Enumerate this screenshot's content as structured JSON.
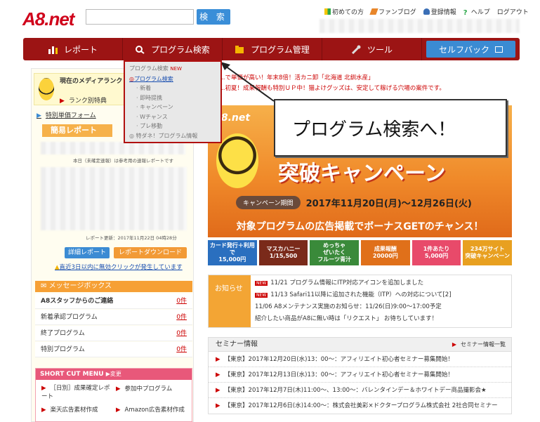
{
  "header": {
    "logo": "A8.net",
    "search_placeholder": "",
    "search_button": "検 索",
    "links": [
      {
        "icon": "beginner-icon",
        "label": "初めての方"
      },
      {
        "icon": "pen-icon",
        "label": "ファンブログ"
      },
      {
        "icon": "user-icon",
        "label": "登録情報"
      },
      {
        "icon": "help-icon",
        "label": "ヘルプ"
      },
      {
        "icon": "",
        "label": "ログアウト"
      }
    ]
  },
  "nav": {
    "items": [
      {
        "icon": "chart-icon",
        "label": "レポート"
      },
      {
        "icon": "search-icon",
        "label": "プログラム検索"
      },
      {
        "icon": "folder-icon",
        "label": "プログラム管理"
      },
      {
        "icon": "wrench-icon",
        "label": "ツール"
      }
    ],
    "selfback": "セルフバック"
  },
  "dropdown": {
    "title": "プログラム検索",
    "badge": "NEW",
    "items": [
      "プログラム検索",
      "新着",
      "即時提携",
      "キャンペーン",
      "Wチャンス",
      "プレ移動"
    ],
    "footer": "特ダネ！プログラム情報"
  },
  "callout": "プログラム検索へ！",
  "left": {
    "media_title": "現在のメディアランク",
    "rank_link": "ランク別特典",
    "price_form": "特別単価フォーム",
    "report_head": "簡易レポート",
    "report_note": "本日（未確定速報）は参考用の速報レポートです",
    "report_updated": "レポート更新：2017年11月22日 04時28分",
    "detail_btn": "詳細レポート",
    "csv_btn": "レポートダウンロード",
    "warning": "直近3日以内に無効クリックが発生しています",
    "msg_head": "メッセージボックス",
    "messages": [
      {
        "label": "A8スタッフからのご連絡",
        "count": "0件"
      },
      {
        "label": "新着承認プログラム",
        "count": "0件"
      },
      {
        "label": "終了プログラム",
        "count": "0件"
      },
      {
        "label": "特別プログラム",
        "count": "0件"
      }
    ],
    "shortcut_head": "SHORT CUT MENU",
    "shortcut_change": "変更",
    "shortcuts": [
      "［日別］成果確定レポート",
      "参加中プログラム",
      "楽天広告素材作成",
      "Amazon広告素材作成"
    ]
  },
  "main": {
    "promo1": "…で単価が高い！年末8倍！活カニ卸「北海道 北釧水産」",
    "promo2": "…初夏！成果報酬も特別ＵＰ中！猫よけグッズは、安定して稼げる穴場の案件です。",
    "campaign": {
      "brand": "A8.net",
      "title": "突破キャンペーン",
      "period_label": "キャンペーン期間",
      "period": "2017年11月20日(月)〜12月26日(火)",
      "tagline": "対象プログラムの広告掲載でボーナスGETのチャンス！"
    },
    "banners": [
      "カード発行＋利用で\n15,000円",
      "マスカハニー\n1/15,500",
      "めっちゃ\nぜいたく\nフルーツ青汁",
      "成果報酬\n20000円",
      "1件あたり\n5,000円",
      "234万サイト\n突破キャンペーン"
    ],
    "news_tag": "お知らせ",
    "news": [
      {
        "new": true,
        "text": "11/21 プログラム情報にITP対応アイコンを追加しました"
      },
      {
        "new": true,
        "text": "11/13 Safari11以降に追加された機能（ITP）への対応について[2]"
      },
      {
        "new": false,
        "text": "11/06 A8メンテナンス実施のお知らせ：11/26(日)9:00〜17:00予定"
      },
      {
        "new": false,
        "text": "紹介したい商品がA8に無い時は「リクエスト」 お待ちしています！"
      }
    ],
    "new_badge": "NEW",
    "seminar_head": "セミナー情報",
    "seminar_link": "セミナー情報一覧",
    "seminars": [
      "【東京】2017年12月20日(水)13：00〜：アフィリエイト初心者セミナー募集開始！",
      "【東京】2017年12月13日(水)13：00〜：アフィリエイト初心者セミナー募集開始！",
      "【東京】2017年12月7日(木)11:00〜、13:00〜：バレンタインデー＆ホワイトデー商品撮影会★",
      "【東京】2017年12月6日(水)14:00〜：株式会社美彩×ドクタープログラム株式会社 2社合同セミナー"
    ]
  },
  "colors": {
    "brand_red": "#d0021b",
    "nav": "#9c1414",
    "accent_blue": "#3b8bd3",
    "orange": "#f6a035"
  }
}
